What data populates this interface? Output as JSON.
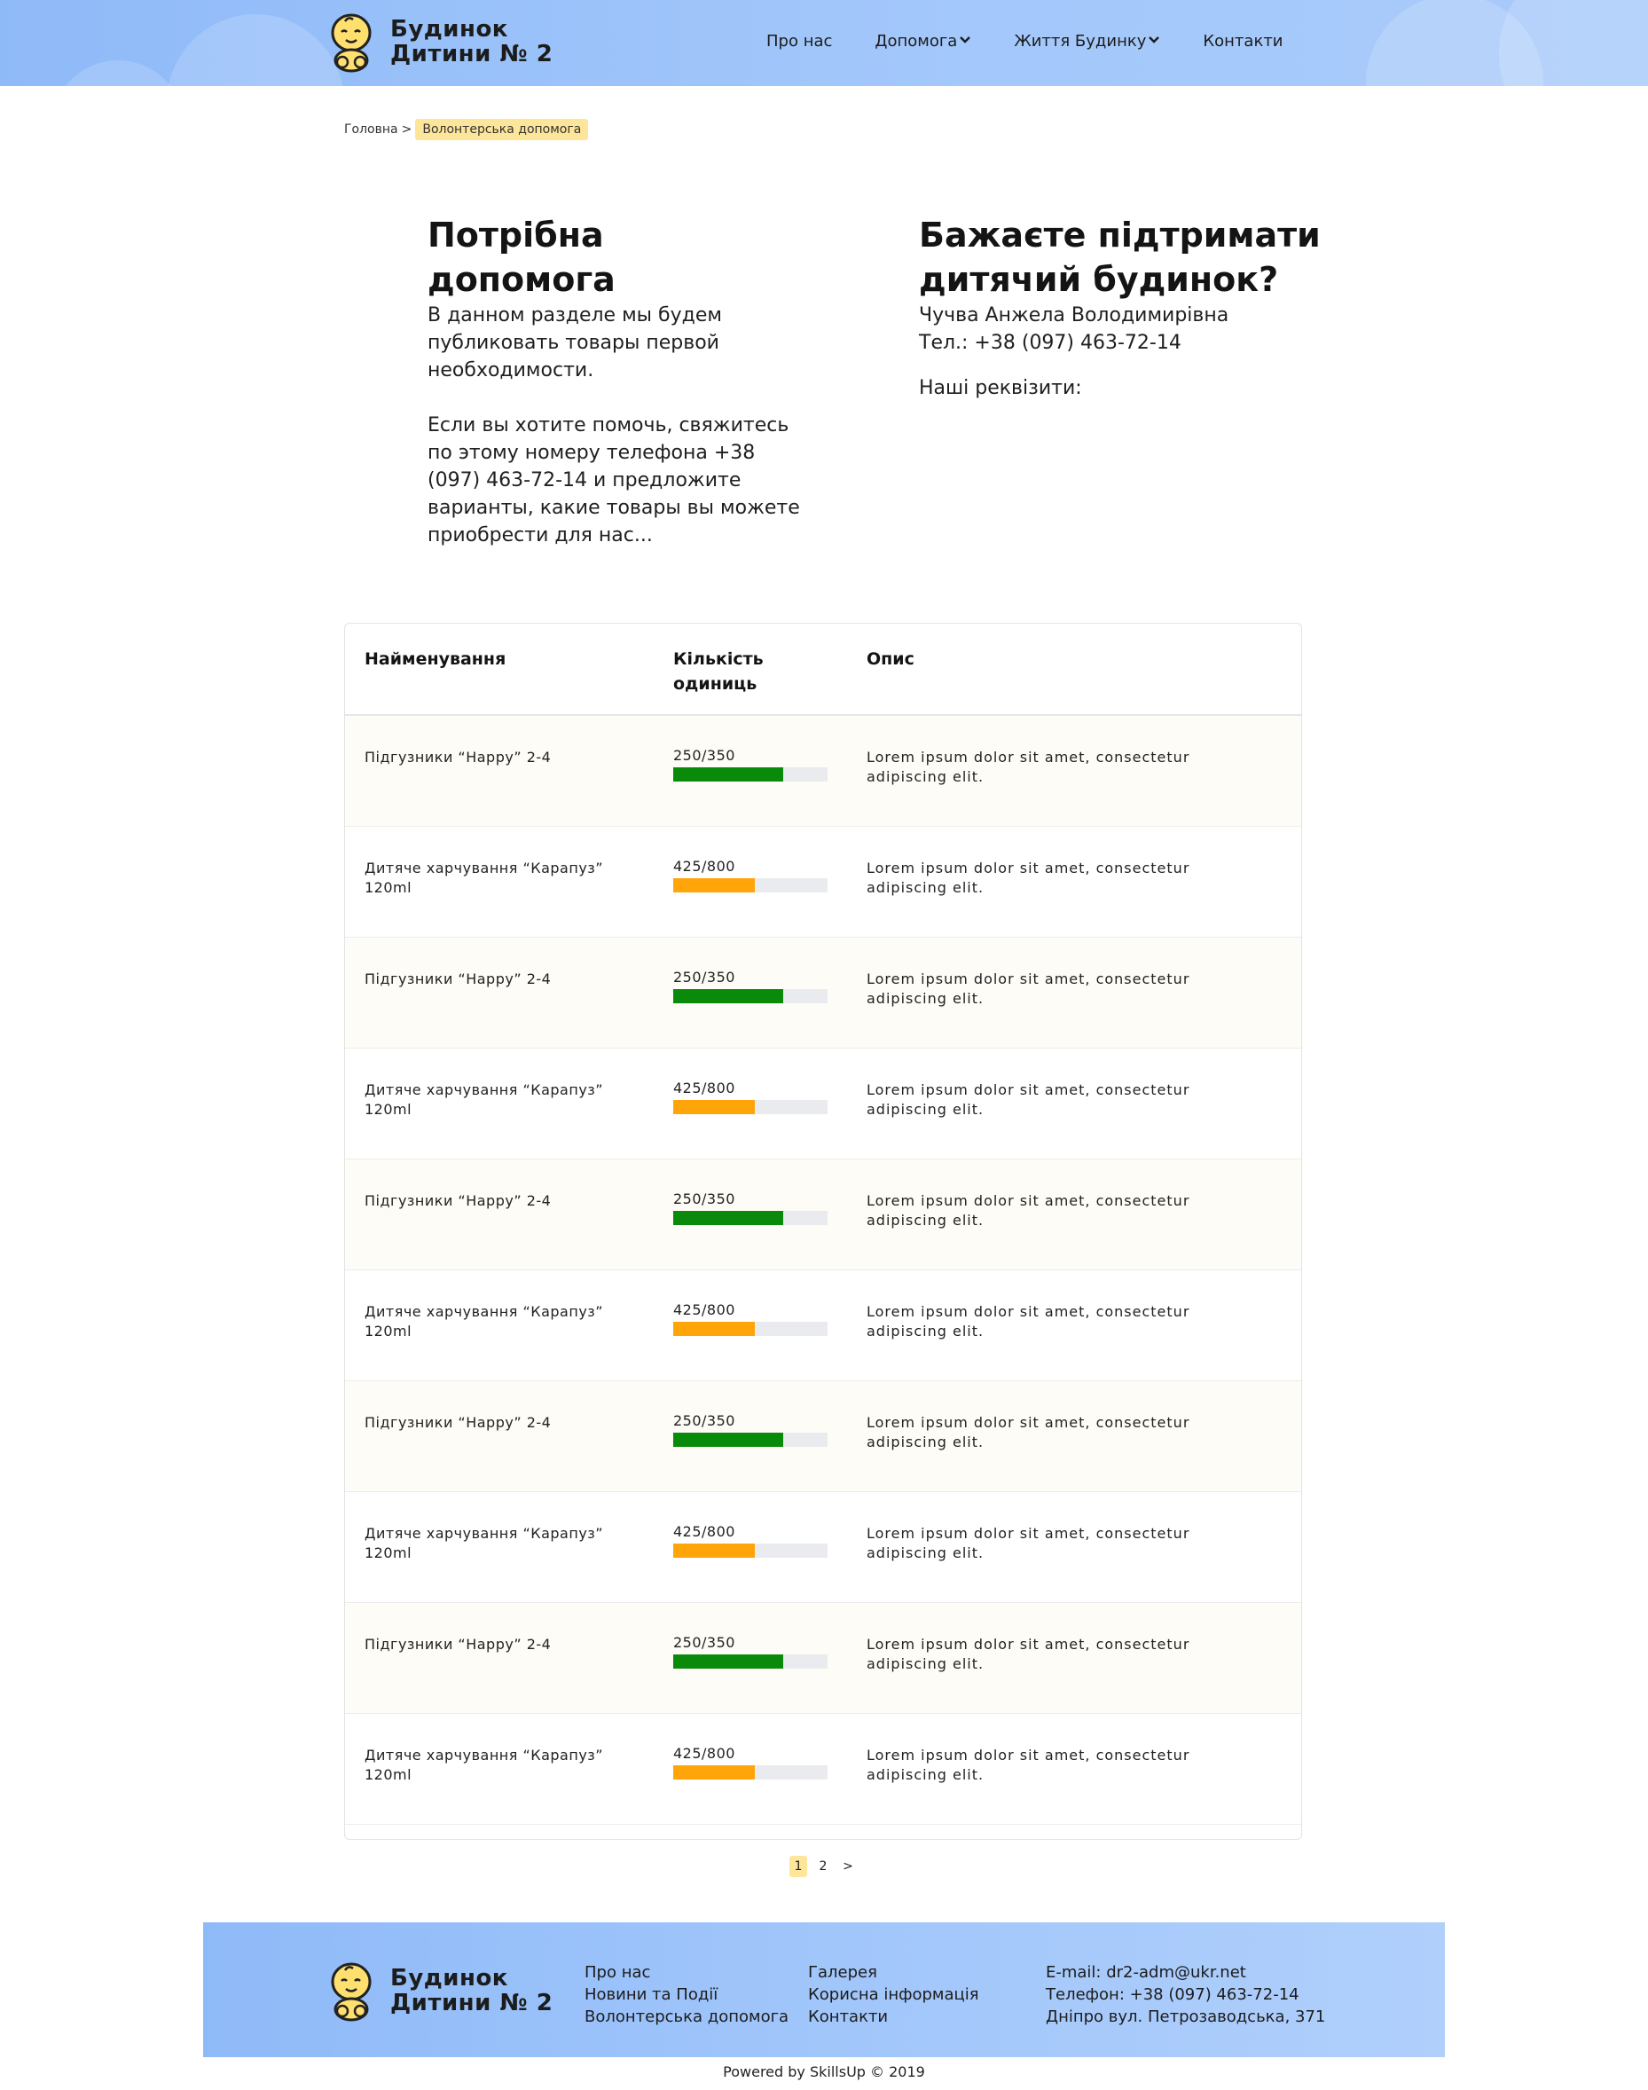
{
  "header": {
    "brand_line1": "Будинок",
    "brand_line2": "Дитини № 2",
    "nav": [
      {
        "label": "Про нас",
        "dropdown": false
      },
      {
        "label": "Допомога",
        "dropdown": true
      },
      {
        "label": "Життя Будинку",
        "dropdown": true
      },
      {
        "label": "Контакти",
        "dropdown": false
      }
    ]
  },
  "breadcrumb": {
    "home": "Головна",
    "separator": ">",
    "current": "Волонтерська допомога"
  },
  "need_help": {
    "title": "Потрібна допомога",
    "text1": "В данном разделе мы будем публиковать товары первой необходимости.",
    "text2": "Если вы хотите помочь, свяжитесь по этому номеру телефона +38 (097) 463-72-14 и предложите варианты, какие товары вы можете приобрести для нас..."
  },
  "support": {
    "title": "Бажаєте підтримати дитячий будинок?",
    "contact_name": "Чучва Анжела Володимирівна",
    "phone": "Тел.: +38 (097) 463-72-14",
    "requisites": "Наші реквізити:"
  },
  "table": {
    "headers": {
      "name": "Найменування",
      "qty": "Кількість одиниць",
      "desc": "Опис"
    },
    "rows": [
      {
        "name": "Підгузники “Happy” 2-4",
        "qty": "250/350",
        "progress": 0.714,
        "color": "#0a8a0a",
        "desc": "Lorem ipsum dolor sit amet, consectetur adipiscing elit."
      },
      {
        "name": "Дитяче харчування “Карапуз” 120ml",
        "qty": "425/800",
        "progress": 0.531,
        "color": "#ffa50a",
        "desc": "Lorem ipsum dolor sit amet, consectetur adipiscing elit."
      },
      {
        "name": "Підгузники “Happy” 2-4",
        "qty": "250/350",
        "progress": 0.714,
        "color": "#0a8a0a",
        "desc": "Lorem ipsum dolor sit amet, consectetur adipiscing elit."
      },
      {
        "name": "Дитяче харчування “Карапуз” 120ml",
        "qty": "425/800",
        "progress": 0.531,
        "color": "#ffa50a",
        "desc": "Lorem ipsum dolor sit amet, consectetur adipiscing elit."
      },
      {
        "name": "Підгузники “Happy” 2-4",
        "qty": "250/350",
        "progress": 0.714,
        "color": "#0a8a0a",
        "desc": "Lorem ipsum dolor sit amet, consectetur adipiscing elit."
      },
      {
        "name": "Дитяче харчування “Карапуз” 120ml",
        "qty": "425/800",
        "progress": 0.531,
        "color": "#ffa50a",
        "desc": "Lorem ipsum dolor sit amet, consectetur adipiscing elit."
      },
      {
        "name": "Підгузники “Happy” 2-4",
        "qty": "250/350",
        "progress": 0.714,
        "color": "#0a8a0a",
        "desc": "Lorem ipsum dolor sit amet, consectetur adipiscing elit."
      },
      {
        "name": "Дитяче харчування “Карапуз” 120ml",
        "qty": "425/800",
        "progress": 0.531,
        "color": "#ffa50a",
        "desc": "Lorem ipsum dolor sit amet, consectetur adipiscing elit."
      },
      {
        "name": "Підгузники “Happy” 2-4",
        "qty": "250/350",
        "progress": 0.714,
        "color": "#0a8a0a",
        "desc": "Lorem ipsum dolor sit amet, consectetur adipiscing elit."
      },
      {
        "name": "Дитяче харчування “Карапуз” 120ml",
        "qty": "425/800",
        "progress": 0.531,
        "color": "#ffa50a",
        "desc": "Lorem ipsum dolor sit amet, consectetur adipiscing elit."
      }
    ]
  },
  "pagination": {
    "pages": [
      "1",
      "2"
    ],
    "next": ">",
    "active": "1"
  },
  "footer": {
    "brand_line1": "Будинок",
    "brand_line2": "Дитини № 2",
    "col1": [
      "Про нас",
      "Новини та Події",
      "Волонтерська допомога"
    ],
    "col2": [
      "Галерея",
      "Корисна інформація",
      "Контакти"
    ],
    "email": "E-mail: dr2-adm@ukr.net",
    "phone": "Телефон: +38 (097) 463-72-14",
    "address": "Дніпро вул. Петрозаводська, 371",
    "copyright": "Powered by SkillsUp © 2019"
  },
  "colors": {
    "header_blue": "#8fbaf8",
    "highlight_yellow": "#fde69a",
    "progress_green": "#0a8a0a",
    "progress_orange": "#ffa50a"
  }
}
